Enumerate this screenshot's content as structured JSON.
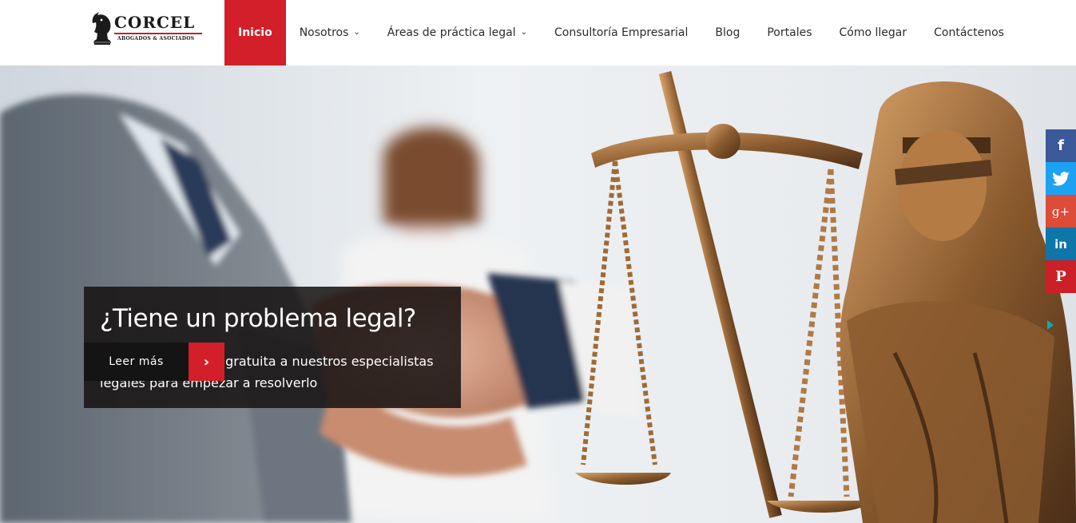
{
  "brand": {
    "name": "CORCEL",
    "subtitle": "ABOGADOS & ASOCIADOS",
    "accent_color": "#d21f2a"
  },
  "nav": {
    "items": [
      {
        "label": "Inicio",
        "active": true
      },
      {
        "label": "Nosotros",
        "dropdown": true
      },
      {
        "label": "Áreas de práctica legal",
        "dropdown": true
      },
      {
        "label": "Consultoría Empresarial"
      },
      {
        "label": "Blog"
      },
      {
        "label": "Portales"
      },
      {
        "label": "Cómo llegar"
      },
      {
        "label": "Contáctenos"
      }
    ]
  },
  "hero": {
    "title": "¿Tiene un problema legal?",
    "text": "Envíe una consulta gratuita a nuestros especialistas legales para empezar a resolverlo",
    "cta_label": "Leer más",
    "cta_icon": "chevron-right-icon"
  },
  "social": {
    "buttons": [
      {
        "icon": "facebook-icon",
        "glyph": "f",
        "color": "#3b5998"
      },
      {
        "icon": "twitter-icon",
        "glyph": "🐦",
        "color": "#1da1f2"
      },
      {
        "icon": "google-plus-icon",
        "glyph": "g+",
        "color": "#dd4b39"
      },
      {
        "icon": "linkedin-icon",
        "glyph": "in",
        "color": "#0e76a8"
      },
      {
        "icon": "pinterest-icon",
        "glyph": "P",
        "color": "#cb2027"
      }
    ],
    "toggle_icon": "triangle-right-icon"
  }
}
